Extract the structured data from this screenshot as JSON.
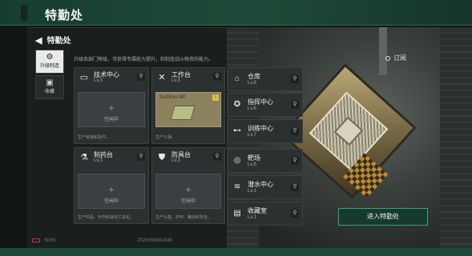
{
  "header": {
    "title": "特勤处"
  },
  "nav": {
    "back_label": "特勤处"
  },
  "tabs": [
    {
      "label": "升级制造",
      "icon": "upgrade-icon",
      "active": true
    },
    {
      "label": "收藏",
      "icon": "collection-icon",
      "active": false
    }
  ],
  "description": "升级各部门等级，可获得专属能力提升，和制造战斗物资的能力。",
  "workshops": [
    {
      "name": "技术中心",
      "level": "Lv.3",
      "icon": "monitor-icon",
      "slot": "空闲中",
      "footer": "生产枪械和配件。"
    },
    {
      "name": "工作台",
      "level": "Lv.3",
      "icon": "tools-icon",
      "slot_item": "9x39mm BP",
      "footer": "生产子弹。"
    },
    {
      "name": "制药台",
      "level": "Lv.3",
      "icon": "flask-icon",
      "slot": "空闲中",
      "footer": "生产药品、针剂和战地工具包。"
    },
    {
      "name": "防具台",
      "level": "Lv.3",
      "icon": "armor-icon",
      "slot": "空闲中",
      "footer": "生产头盔、护甲、胸挂和背包。"
    }
  ],
  "facilities": [
    {
      "name": "仓库",
      "level": "Lv.8",
      "icon": "warehouse-icon"
    },
    {
      "name": "指挥中心",
      "level": "Lv.6",
      "icon": "command-icon"
    },
    {
      "name": "训练中心",
      "level": "Lv.7",
      "icon": "dumbbell-icon"
    },
    {
      "name": "靶场",
      "level": "Lv.5",
      "icon": "target-icon"
    },
    {
      "name": "潜水中心",
      "level": "Lv.1",
      "icon": "diving-icon"
    },
    {
      "name": "收藏室",
      "level": "Lv.1",
      "icon": "vault-icon"
    }
  ],
  "subscribe_label": "订阅",
  "enter_button": "进入特勤处",
  "status": {
    "fps": "50Hz",
    "uid": "2026050681848"
  },
  "colors": {
    "accent": "#3aa276",
    "banner": "#1d4a38"
  }
}
